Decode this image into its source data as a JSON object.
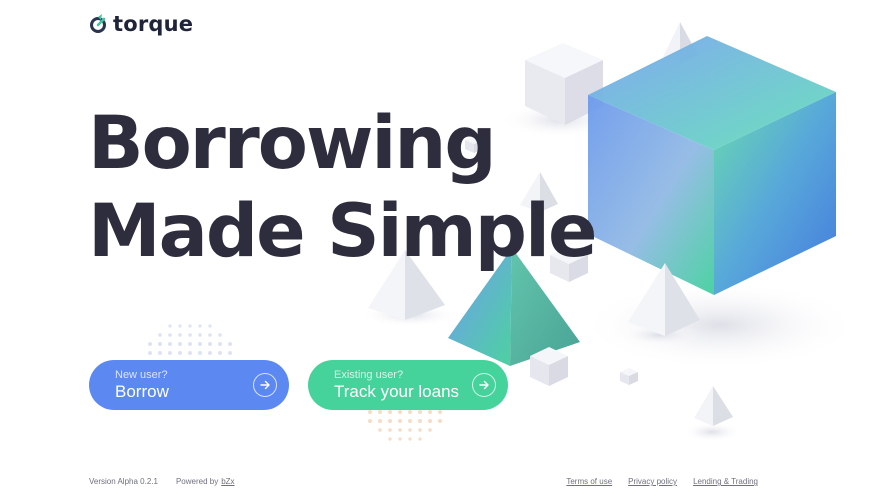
{
  "brand": {
    "name": "torque"
  },
  "hero": {
    "line1": "Borrowing",
    "line2": "Made Simple"
  },
  "actions": {
    "borrow": {
      "subtitle": "New user?",
      "label": "Borrow"
    },
    "track": {
      "subtitle": "Existing user?",
      "label": "Track your loans"
    }
  },
  "footer": {
    "version": "Version Alpha 0.2.1",
    "powered_prefix": "Powered by",
    "powered_link": "bZx",
    "links": [
      "Terms of use",
      "Privacy policy",
      "Lending & Trading"
    ]
  },
  "colors": {
    "primary_blue": "#5c88f2",
    "primary_green": "#46d29b",
    "title": "#2e2d3d"
  }
}
